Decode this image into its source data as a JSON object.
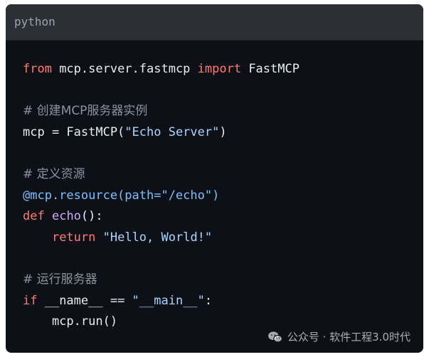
{
  "code_block": {
    "language": "python",
    "lines": [
      {
        "t1": "from",
        "t2": " mcp.server.fastmcp ",
        "t3": "import",
        "t4": " FastMCP"
      },
      {
        "text": ""
      },
      {
        "comment": "# 创建MCP服务器实例"
      },
      {
        "a": "mcp = FastMCP(",
        "b": "\"Echo Server\"",
        "c": ")"
      },
      {
        "text": ""
      },
      {
        "comment": "# 定义资源"
      },
      {
        "decorator": "@mcp.resource(path=\"/echo\")"
      },
      {
        "kw": "def",
        "sp": " ",
        "fn": "echo",
        "rest": "():"
      },
      {
        "indent": "    ",
        "kw": "return",
        "sp": " ",
        "str": "\"Hello, World!\""
      },
      {
        "text": ""
      },
      {
        "comment": "# 运行服务器"
      },
      {
        "kw": "if",
        "mid": " __name__ == ",
        "str": "\"__main__\"",
        "end": ":"
      },
      {
        "text": "    mcp.run()"
      }
    ]
  },
  "watermark": {
    "text": "公众号 · 软件工程3.0时代",
    "icon": "wechat-icon"
  },
  "colors": {
    "background": "#0d1117",
    "header": "#2c2f35",
    "keyword": "#ff7b72",
    "string": "#a5d6ff",
    "comment": "#8b949e",
    "function": "#d2a8ff",
    "decorator": "#79c0ff",
    "text": "#e6edf3"
  }
}
